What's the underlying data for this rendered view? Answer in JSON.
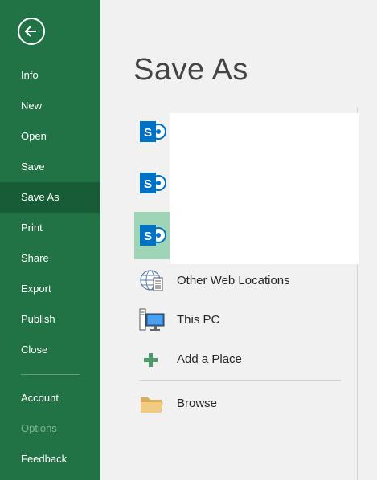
{
  "sidebar": {
    "items": [
      {
        "label": "Info"
      },
      {
        "label": "New"
      },
      {
        "label": "Open"
      },
      {
        "label": "Save"
      },
      {
        "label": "Save As"
      },
      {
        "label": "Print"
      },
      {
        "label": "Share"
      },
      {
        "label": "Export"
      },
      {
        "label": "Publish"
      },
      {
        "label": "Close"
      },
      {
        "label": "Account"
      },
      {
        "label": "Options"
      },
      {
        "label": "Feedback"
      }
    ],
    "selected": "Save As",
    "disabled": [
      "Options"
    ]
  },
  "main": {
    "title": "Save As",
    "sharepoint_locations": [
      {
        "icon": "sharepoint-icon"
      },
      {
        "icon": "sharepoint-icon"
      },
      {
        "icon": "sharepoint-icon",
        "selected": true
      }
    ],
    "locations": [
      {
        "label": "Other Web Locations",
        "icon": "globe-document-icon"
      },
      {
        "label": "This PC",
        "icon": "computer-icon"
      },
      {
        "label": "Add a Place",
        "icon": "plus-icon"
      },
      {
        "label": "Browse",
        "icon": "folder-icon"
      }
    ]
  },
  "colors": {
    "sidebar": "#217346",
    "sidebar_selected": "#185c37",
    "selected_tile": "#9fd5b7",
    "background": "#f1f1f1",
    "sharepoint_blue": "#0072c6"
  }
}
